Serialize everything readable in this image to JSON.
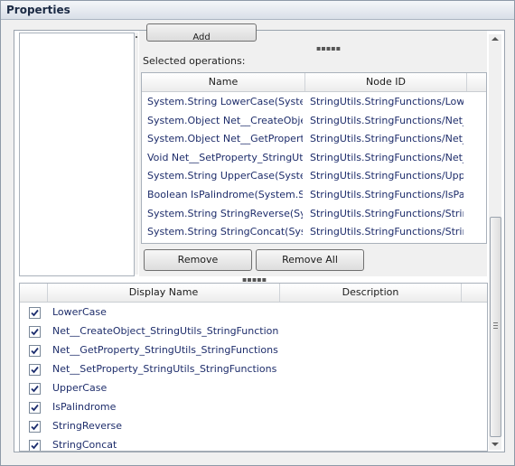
{
  "window": {
    "title": "Properties"
  },
  "top_pane": {
    "add_button_label": "Add",
    "selected_label": "Selected operations:",
    "columns": [
      "Name",
      "Node ID"
    ],
    "rows": [
      {
        "name": "System.String LowerCase(System",
        "node_id": "StringUtils.StringFunctions/Lowe"
      },
      {
        "name": "System.Object Net__CreateObje",
        "node_id": "StringUtils.StringFunctions/Net_"
      },
      {
        "name": "System.Object Net__GetPropert",
        "node_id": "StringUtils.StringFunctions/Net_"
      },
      {
        "name": "Void Net__SetProperty_StringUt",
        "node_id": "StringUtils.StringFunctions/Net_"
      },
      {
        "name": "System.String UpperCase(Syster",
        "node_id": "StringUtils.StringFunctions/Uppe"
      },
      {
        "name": "Boolean IsPalindrome(System.St",
        "node_id": "StringUtils.StringFunctions/IsPal"
      },
      {
        "name": "System.String StringReverse(Sys",
        "node_id": "StringUtils.StringFunctions/Strin"
      },
      {
        "name": "System.String StringConcat(Syst",
        "node_id": "StringUtils.StringFunctions/Strin"
      }
    ],
    "remove_label": "Remove",
    "remove_all_label": "Remove All"
  },
  "bottom_pane": {
    "columns": [
      "Display Name",
      "Description"
    ],
    "rows": [
      {
        "checked": true,
        "display_name": "LowerCase",
        "description": ""
      },
      {
        "checked": true,
        "display_name": "Net__CreateObject_StringUtils_StringFunctions",
        "description": ""
      },
      {
        "checked": true,
        "display_name": "Net__GetProperty_StringUtils_StringFunctions",
        "description": ""
      },
      {
        "checked": true,
        "display_name": "Net__SetProperty_StringUtils_StringFunctions",
        "description": ""
      },
      {
        "checked": true,
        "display_name": "UpperCase",
        "description": ""
      },
      {
        "checked": true,
        "display_name": "IsPalindrome",
        "description": ""
      },
      {
        "checked": true,
        "display_name": "StringReverse",
        "description": ""
      },
      {
        "checked": true,
        "display_name": "StringConcat",
        "description": ""
      }
    ]
  },
  "colors": {
    "link_text": "#1e2d6b",
    "title_text": "#1b2a44"
  }
}
